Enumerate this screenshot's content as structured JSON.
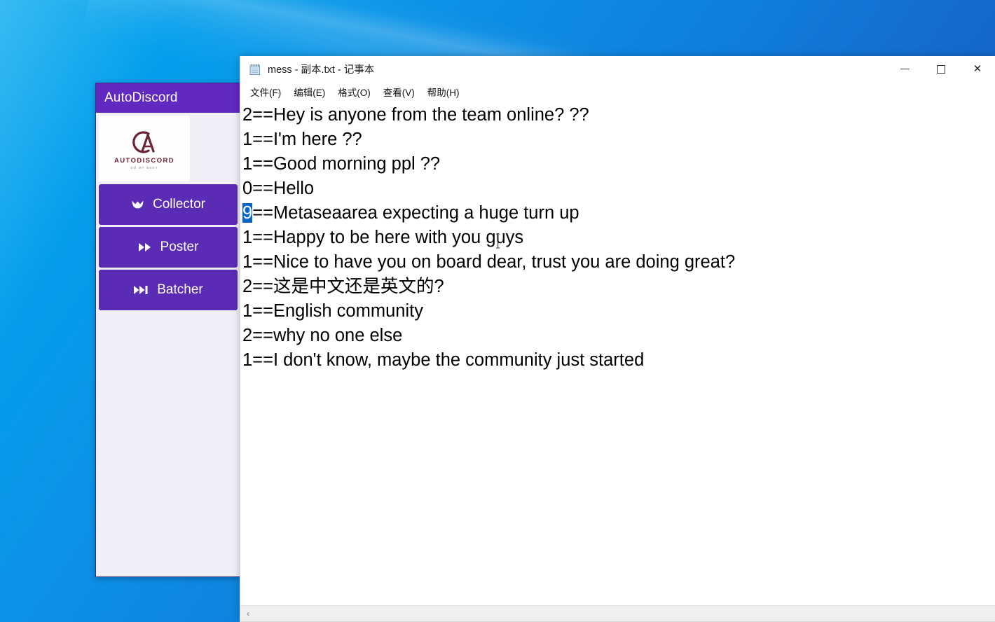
{
  "desktop": {
    "wallpaper_top_color": "#1a54b8",
    "wallpaper_bottom_color": "#00a8f0"
  },
  "autodiscord": {
    "title": "AutoDiscord",
    "header_color": "#6129c0",
    "button_color": "#5a2cb5",
    "body_color": "#f0eef7",
    "logo": {
      "monogram": "CA",
      "wordmark": "AUTODISCORD",
      "tagline": "DO MY BEST",
      "color": "#6b2233"
    },
    "buttons": [
      {
        "label": "Collector",
        "icon": "collector-scoop-icon",
        "glyph": "⤵"
      },
      {
        "label": "Poster",
        "icon": "fast-forward-icon",
        "glyph": "⏩"
      },
      {
        "label": "Batcher",
        "icon": "skip-forward-icon",
        "glyph": "⏭"
      }
    ]
  },
  "notepad": {
    "title": "mess - 副本.txt - 记事本",
    "icon": "notepad-icon",
    "window_controls": {
      "minimize": "—",
      "maximize": "☐",
      "close": "✕"
    },
    "menu": [
      "文件(F)",
      "编辑(E)",
      "格式(O)",
      "查看(V)",
      "帮助(H)"
    ],
    "selection": {
      "line_index": 4,
      "selected_text": "9",
      "highlight_color": "#0a64c8"
    },
    "lines": [
      "2==Hey is anyone from the team online? ??",
      "1==I'm here ??",
      "1==Good morning ppl ??",
      "0==Hello",
      "9==Metaseaarea expecting a huge turn up",
      "1==Happy to be here with you guys",
      "1==Nice to have you on board dear, trust you are doing great?",
      "2==这是中文还是英文的?",
      "1==English community",
      "2==why no one else",
      "1==I don't know, maybe the community just started"
    ],
    "hscroll_left_arrow": "‹"
  }
}
